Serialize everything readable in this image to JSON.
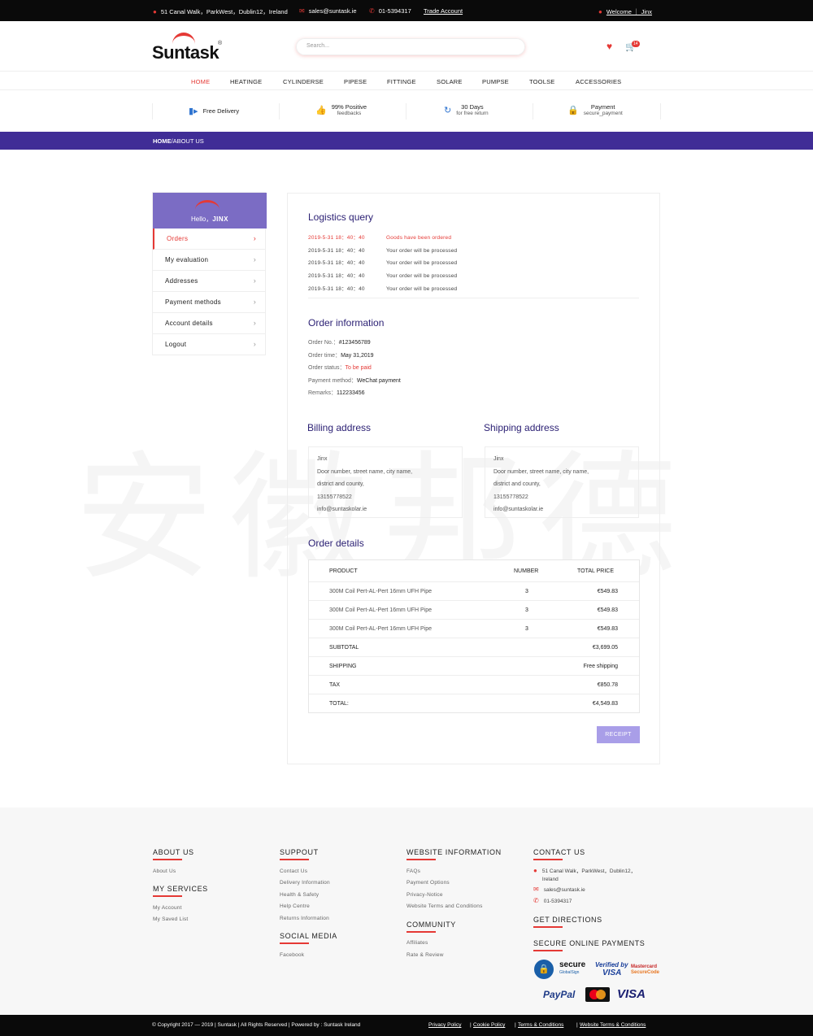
{
  "topbar": {
    "address": "51 Canal Walk，ParkWest，Dublin12，Ireland",
    "email": "sales@suntask.ie",
    "phone": "01-5394317",
    "trade": "Trade Account",
    "welcome": "Welcome ｜ Jinx"
  },
  "header": {
    "logo": "Suntask",
    "logo_mark": "®",
    "search_placeholder": "Search...",
    "cart_count": "14"
  },
  "nav": [
    "HOME",
    "HEATINGE",
    "CYLINDERSE",
    "PIPESE",
    "FITTINGE",
    "SOLARE",
    "PUMPSE",
    "TOOLSE",
    "ACCESSORIES"
  ],
  "features": [
    {
      "t1": "Free Delivery",
      "t2": ""
    },
    {
      "t1": "99% Positive",
      "t2": "feedbacks"
    },
    {
      "t1": "30 Days",
      "t2": "for free return"
    },
    {
      "t1": "Payment",
      "t2": "secure_payment"
    }
  ],
  "breadcrumb": {
    "home": "HOME",
    "current": "/ABOUT US"
  },
  "watermark": "安徽邦德",
  "sidebar": {
    "hello": "Hello，",
    "name": "JINX",
    "items": [
      "Orders",
      "My evaluation",
      "Addresses",
      "Payment methods",
      "Account details",
      "Logout"
    ]
  },
  "logistics": {
    "title": "Logistics query",
    "rows": [
      {
        "time": "2019-5-31 18：40：40",
        "msg": "Goods have been ordered"
      },
      {
        "time": "2019-5-31 18：40：40",
        "msg": "Your order will be processed"
      },
      {
        "time": "2019-5-31 18：40：40",
        "msg": "Your order will be processed"
      },
      {
        "time": "2019-5-31 18：40：40",
        "msg": "Your order will be processed"
      },
      {
        "time": "2019-5-31 18：40：40",
        "msg": "Your order will be processed"
      }
    ]
  },
  "order_info": {
    "title": "Order information",
    "rows": [
      {
        "k": "Order No.：",
        "v": "#123456789"
      },
      {
        "k": "Order time：",
        "v": "May 31,2019"
      },
      {
        "k": "Order status：",
        "v": "To be paid"
      },
      {
        "k": "Payment method：",
        "v": "WeChat payment"
      },
      {
        "k": "Remarks：",
        "v": "112233456"
      }
    ]
  },
  "billing": {
    "title": "Billing address",
    "lines": [
      "Jinx",
      "Door number, street name, city name,",
      "district and county,",
      "13155778522",
      "info@suntaskolar.ie"
    ]
  },
  "shipping": {
    "title": "Shipping address",
    "lines": [
      "Jinx",
      "Door number, street name, city name,",
      "district and county,",
      "13155778522",
      "info@suntaskolar.ie"
    ]
  },
  "order_details": {
    "title": "Order details",
    "headers": {
      "product": "PRODUCT",
      "number": "NUMBER",
      "price": "TOTAL PRICE"
    },
    "items": [
      {
        "product": "300M Coil Pert-AL-Pert 16mm UFH Pipe",
        "number": "3",
        "price": "€549.83"
      },
      {
        "product": "300M Coil Pert-AL-Pert 16mm UFH Pipe",
        "number": "3",
        "price": "€549.83"
      },
      {
        "product": "300M Coil Pert-AL-Pert 16mm UFH Pipe",
        "number": "3",
        "price": "€549.83"
      }
    ],
    "totals": [
      {
        "k": "SUBTOTAL",
        "v": "€3,699.05"
      },
      {
        "k": "SHIPPING",
        "v": "Free shipping"
      },
      {
        "k": "TAX",
        "v": "€850.78"
      },
      {
        "k": "TOTAL:",
        "v": "€4,549.83"
      }
    ],
    "receipt": "RECEIPT"
  },
  "footer": {
    "about": {
      "title": "ABOUT US",
      "links": [
        "About Us"
      ]
    },
    "services": {
      "title": "MY SERVICES",
      "links": [
        "My Account",
        "My Saved List"
      ]
    },
    "support": {
      "title": "SUPPOUT",
      "links": [
        "Contact Us",
        "Delivery Information",
        "Health & Safety",
        "Help Centre",
        "Returns Information"
      ]
    },
    "social": {
      "title": "SOCIAL MEDIA",
      "links": [
        "Facebook"
      ]
    },
    "website": {
      "title": "WEBSITE INFORMATION",
      "links": [
        "FAQs",
        "Payment Options",
        "Privacy-Notice",
        "Website Terms and Conditions"
      ]
    },
    "community": {
      "title": "COMMUNITY",
      "links": [
        "Affiliates",
        "Rate & Review"
      ]
    },
    "contact": {
      "title": "CONTACT US",
      "address1": "51 Canal Walk，ParkWest，Dublin12，",
      "address2": "Ireland",
      "email": "sales@suntask.ie",
      "phone": "01-5394317"
    },
    "directions": "GET DIRECTIONS",
    "payments_title": "SECURE ONLINE PAYMENTS",
    "payments": {
      "secure": "secure",
      "globalsign": "GlobalSign",
      "verified": "Verified by",
      "visa": "VISA",
      "mc1": "Mastercard",
      "mc2": "SecureCode",
      "paypal": "PayPal",
      "visa2": "VISA"
    }
  },
  "bottom": {
    "copyright": "© Copyright 2017 — 2019 | Suntask | All Rights Reserved | Powered by : Suntask Ireland",
    "links": [
      "Privacy Policy",
      "Cookie Policy",
      "Terms & Conditions",
      "Website Terms & Conditions"
    ]
  },
  "colors": {
    "accent": "#e53935",
    "brand": "#402d96",
    "panel": "#7b6cc4",
    "button": "#a99ee8"
  }
}
